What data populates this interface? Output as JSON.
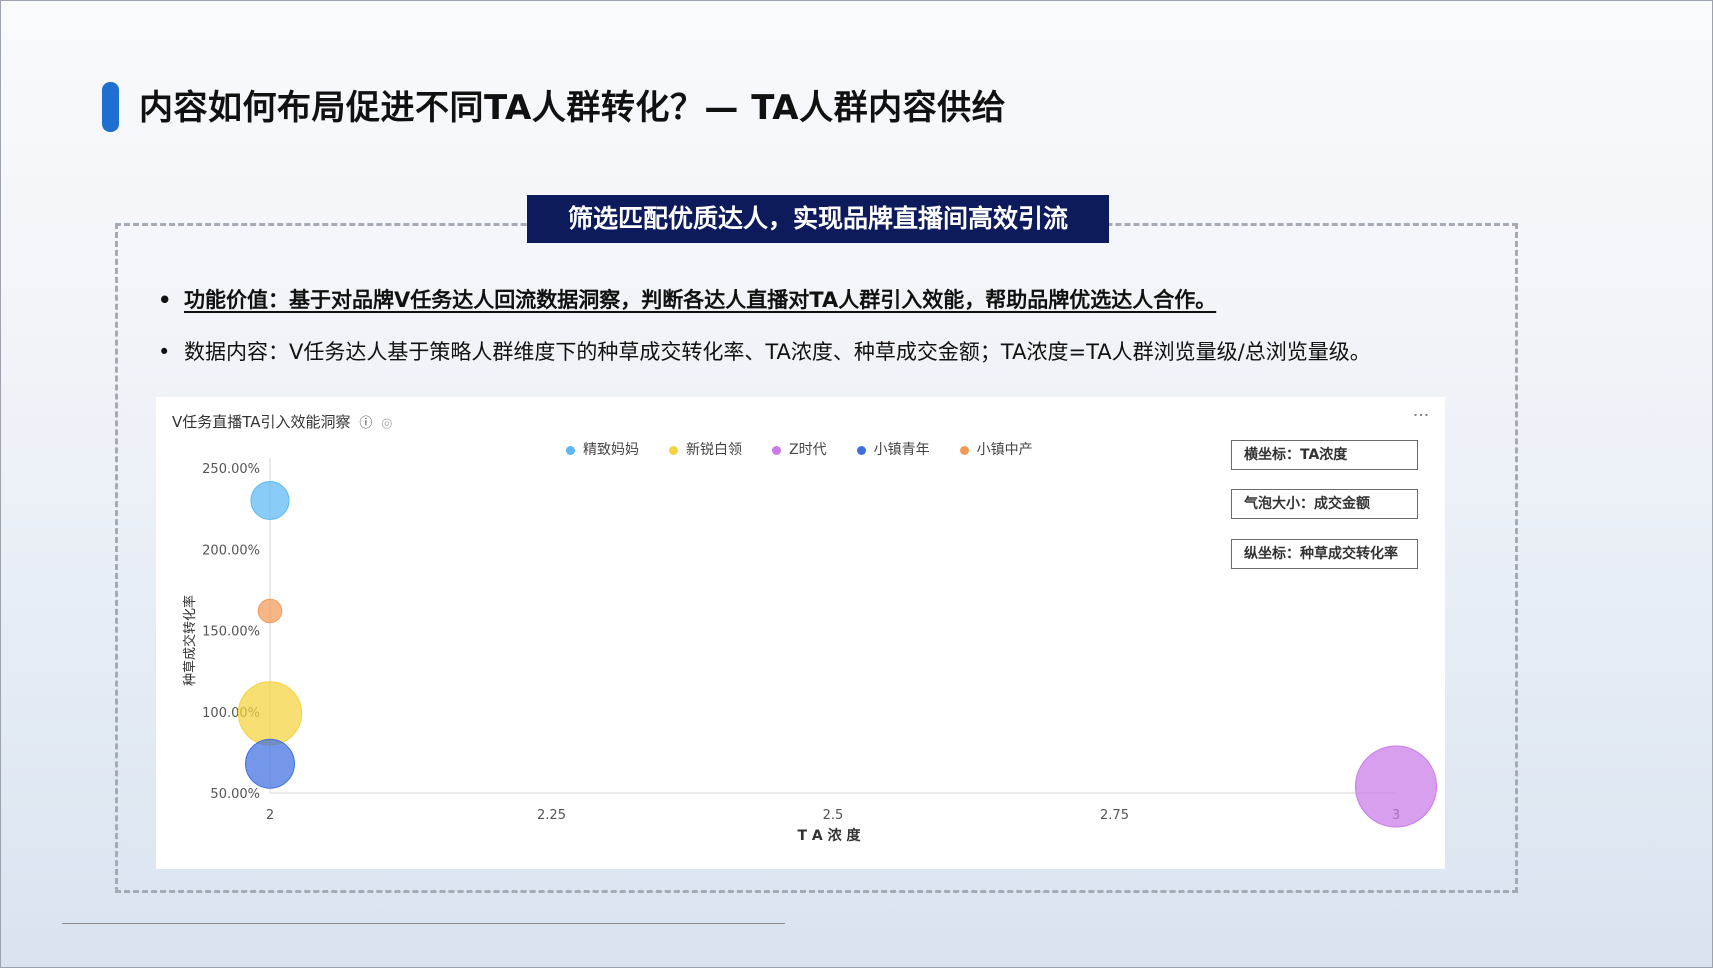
{
  "slide": {
    "title": "内容如何布局促进不同TA人群转化？— TA人群内容供给",
    "banner": "筛选匹配优质达人，实现品牌直播间高效引流",
    "bullets": [
      {
        "marker": "•",
        "text": "功能价值：基于对品牌V任务达人回流数据洞察，判断各达人直播对TA人群引入效能，帮助品牌优选达人合作。"
      },
      {
        "marker": "•",
        "text": "数据内容：V任务达人基于策略人群维度下的种草成交转化率、TA浓度、种草成交金额；TA浓度=TA人群浏览量级/总浏览量级。"
      }
    ]
  },
  "panel": {
    "title": "V任务直播TA引入效能洞察",
    "info_icon": "info-circle-icon",
    "eye_icon": "eye-icon",
    "more_icon": "more-vertical-icon",
    "more_glyph": "⋮",
    "info_glyph": "ⓘ",
    "eye_glyph": "◎",
    "notes": [
      "横坐标：TA浓度",
      "气泡大小：成交金额",
      "纵坐标：种草成交转化率"
    ]
  },
  "chart_data": {
    "type": "scatter",
    "subtype": "bubble",
    "xlabel": "T A 浓 度",
    "ylabel": "种草成交转化率",
    "xlim": [
      2,
      3
    ],
    "ylim": [
      50,
      250
    ],
    "x_ticks": [
      "2",
      "2.25",
      "2.5",
      "2.75",
      "3"
    ],
    "y_ticks": [
      "50.00%",
      "100.00%",
      "150.00%",
      "200.00%",
      "250.00%"
    ],
    "y_tick_values": [
      50,
      100,
      150,
      200,
      250
    ],
    "x_tick_values": [
      2,
      2.25,
      2.5,
      2.75,
      3
    ],
    "legend_position": "top-center",
    "series": [
      {
        "name": "精致妈妈",
        "color": "#5bb8f5",
        "points": [
          {
            "x": 2.0,
            "y": 230,
            "size": 1.0
          }
        ]
      },
      {
        "name": "新锐白领",
        "color": "#f5d33f",
        "points": [
          {
            "x": 2.0,
            "y": 99,
            "size": 3.2
          }
        ]
      },
      {
        "name": "Z时代",
        "color": "#c97ae8",
        "points": [
          {
            "x": 3.0,
            "y": 54,
            "size": 5.5
          }
        ]
      },
      {
        "name": "小镇青年",
        "color": "#3f6fe0",
        "points": [
          {
            "x": 2.0,
            "y": 68,
            "size": 1.8
          }
        ]
      },
      {
        "name": "小镇中产",
        "color": "#f39a5a",
        "points": [
          {
            "x": 2.0,
            "y": 162,
            "size": 0.3
          }
        ]
      }
    ]
  }
}
